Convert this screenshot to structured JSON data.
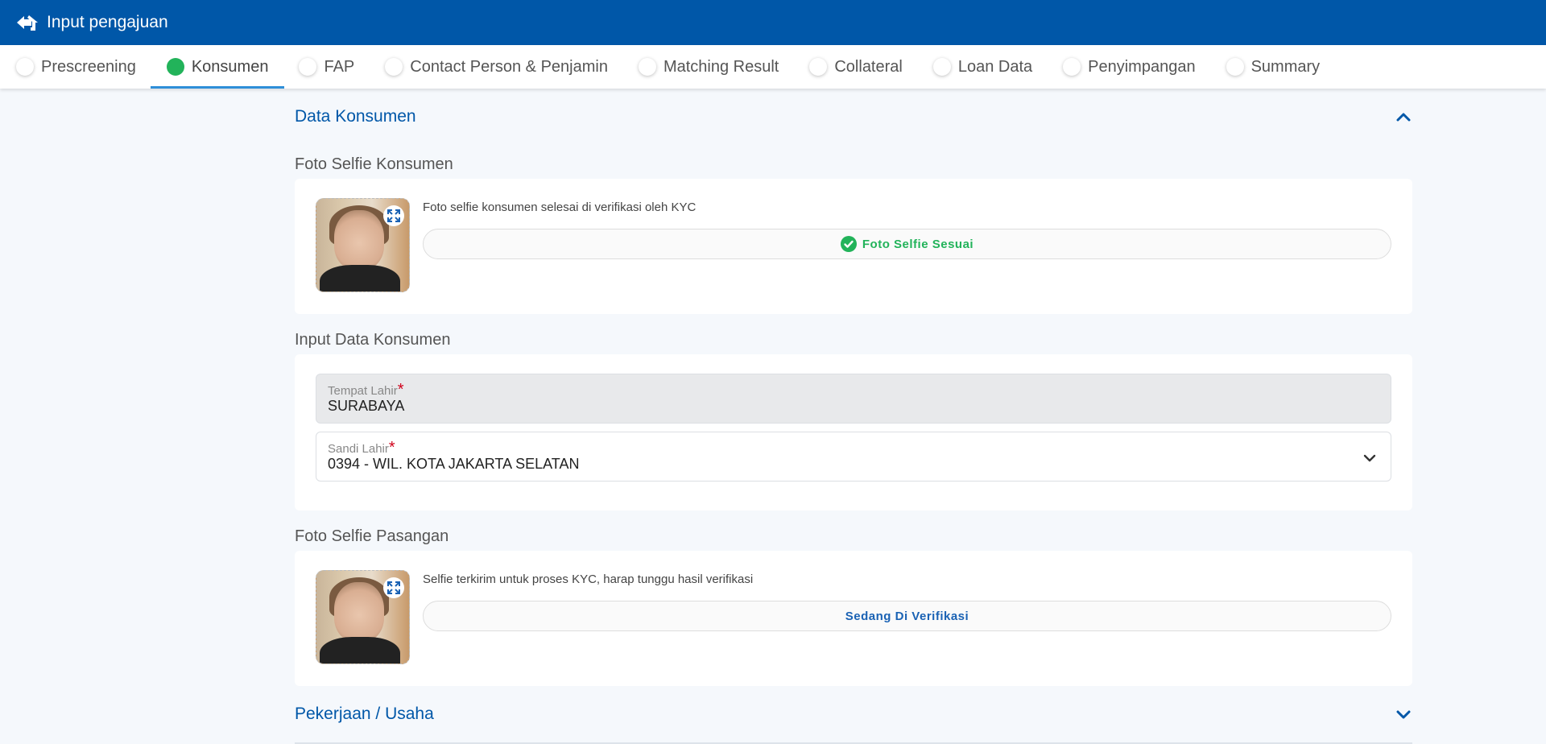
{
  "header": {
    "title": "Input pengajuan",
    "back_icon": "home-back-icon"
  },
  "tabs": [
    {
      "label": "Prescreening",
      "active": false
    },
    {
      "label": "Konsumen",
      "active": true
    },
    {
      "label": "FAP",
      "active": false
    },
    {
      "label": "Contact Person & Penjamin",
      "active": false
    },
    {
      "label": "Matching Result",
      "active": false
    },
    {
      "label": "Collateral",
      "active": false
    },
    {
      "label": "Loan Data",
      "active": false
    },
    {
      "label": "Penyimpangan",
      "active": false
    },
    {
      "label": "Summary",
      "active": false
    }
  ],
  "data_konsumen": {
    "title": "Data Konsumen",
    "expanded": true,
    "foto_selfie": {
      "title": "Foto Selfie Konsumen",
      "note": "Foto selfie konsumen selesai di verifikasi oleh KYC",
      "status": "Foto Selfie Sesuai"
    },
    "input": {
      "title": "Input Data Konsumen",
      "tempat_lahir": {
        "label": "Tempat Lahir",
        "required": "*",
        "value": "SURABAYA"
      },
      "sandi_lahir": {
        "label": "Sandi Lahir",
        "required": "*",
        "value": "0394 - WIL. KOTA JAKARTA SELATAN"
      }
    },
    "foto_pasangan": {
      "title": "Foto Selfie Pasangan",
      "note": "Selfie terkirim untuk proses KYC, harap tunggu hasil verifikasi",
      "status": "Sedang Di Verifikasi"
    }
  },
  "pekerjaan": {
    "title": "Pekerjaan / Usaha",
    "expanded": false
  },
  "colors": {
    "brand": "#0057a8",
    "success": "#22b35a",
    "pending": "#1a62b4",
    "required": "#d0021b"
  }
}
